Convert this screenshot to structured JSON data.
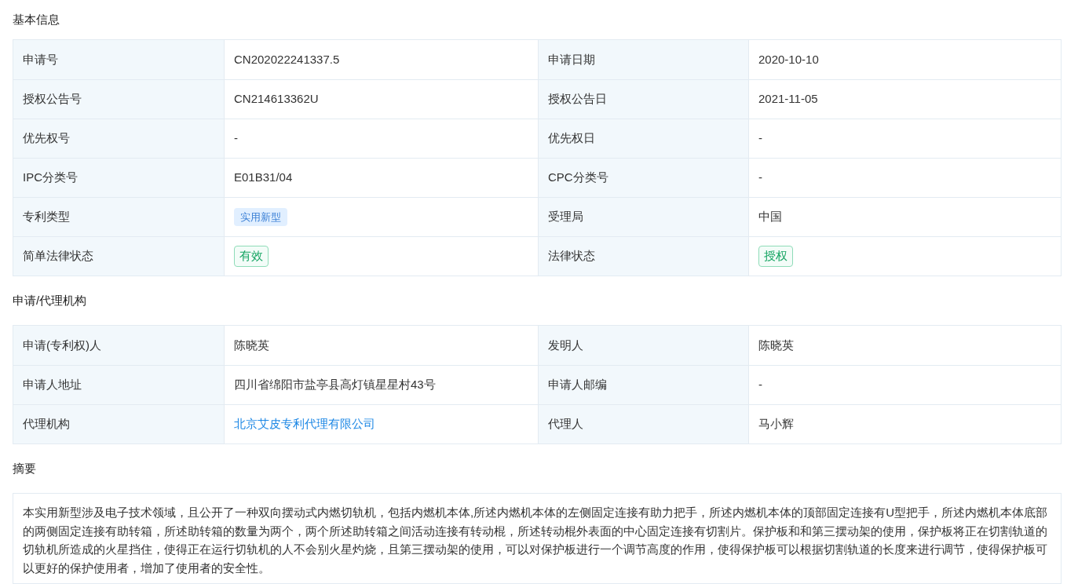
{
  "sections": [
    {
      "kind": "table",
      "title": "基本信息",
      "rows": [
        [
          {
            "label": "申请号",
            "value": "CN202022241337.5",
            "kind": "text"
          },
          {
            "label": "申请日期",
            "value": "2020-10-10",
            "kind": "text"
          }
        ],
        [
          {
            "label": "授权公告号",
            "value": "CN214613362U",
            "kind": "text"
          },
          {
            "label": "授权公告日",
            "value": "2021-11-05",
            "kind": "text"
          }
        ],
        [
          {
            "label": "优先权号",
            "value": "-",
            "kind": "text"
          },
          {
            "label": "优先权日",
            "value": "-",
            "kind": "text"
          }
        ],
        [
          {
            "label": "IPC分类号",
            "value": "E01B31/04",
            "kind": "text"
          },
          {
            "label": "CPC分类号",
            "value": "-",
            "kind": "text"
          }
        ],
        [
          {
            "label": "专利类型",
            "value": "实用新型",
            "kind": "tag"
          },
          {
            "label": "受理局",
            "value": "中国",
            "kind": "text"
          }
        ],
        [
          {
            "label": "简单法律状态",
            "value": "有效",
            "kind": "status"
          },
          {
            "label": "法律状态",
            "value": "授权",
            "kind": "status"
          }
        ]
      ]
    },
    {
      "kind": "table",
      "title": "申请/代理机构",
      "rows": [
        [
          {
            "label": "申请(专利权)人",
            "value": "陈晓英",
            "kind": "text"
          },
          {
            "label": "发明人",
            "value": "陈晓英",
            "kind": "text"
          }
        ],
        [
          {
            "label": "申请人地址",
            "value": "四川省绵阳市盐亭县高灯镇星星村43号",
            "kind": "text"
          },
          {
            "label": "申请人邮编",
            "value": "-",
            "kind": "text"
          }
        ],
        [
          {
            "label": "代理机构",
            "value": "北京艾皮专利代理有限公司",
            "kind": "link"
          },
          {
            "label": "代理人",
            "value": "马小辉",
            "kind": "text"
          }
        ]
      ]
    },
    {
      "kind": "text",
      "title": "摘要",
      "text": "本实用新型涉及电子技术领域，且公开了一种双向摆动式内燃切轨机，包括内燃机本体,所述内燃机本体的左侧固定连接有助力把手，所述内燃机本体的顶部固定连接有U型把手，所述内燃机本体底部的两侧固定连接有助转箱，所述助转箱的数量为两个，两个所述助转箱之间活动连接有转动棍，所述转动棍外表面的中心固定连接有切割片。保护板和和第三摆动架的使用，保护板将正在切割轨道的切轨机所造成的火星挡住，使得正在运行切轨机的人不会别火星灼烧，且第三摆动架的使用，可以对保护板进行一个调节高度的作用，使得保护板可以根据切割轨道的长度来进行调节，使得保护板可以更好的保护使用者，增加了使用者的安全性。"
    }
  ]
}
